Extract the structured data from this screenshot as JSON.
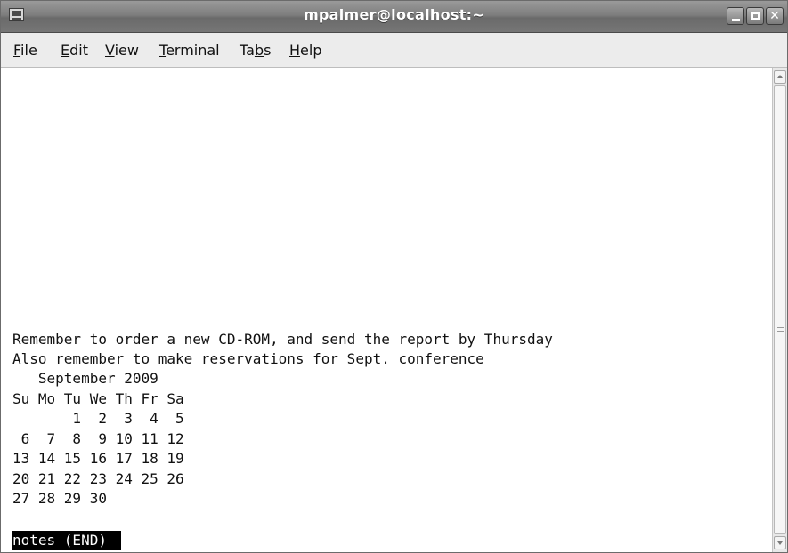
{
  "window": {
    "title": "mpalmer@localhost:~"
  },
  "menu": {
    "items": [
      {
        "pre": "",
        "key": "F",
        "post": "ile"
      },
      {
        "pre": "",
        "key": "E",
        "post": "dit"
      },
      {
        "pre": "",
        "key": "V",
        "post": "iew"
      },
      {
        "pre": "",
        "key": "T",
        "post": "erminal"
      },
      {
        "pre": "Ta",
        "key": "b",
        "post": "s"
      },
      {
        "pre": "",
        "key": "H",
        "post": "elp"
      }
    ]
  },
  "terminal": {
    "lines": [
      "Remember to order a new CD-ROM, and send the report by Thursday",
      "Also remember to make reservations for Sept. conference",
      "   September 2009",
      "Su Mo Tu We Th Fr Sa",
      "       1  2  3  4  5",
      " 6  7  8  9 10 11 12",
      "13 14 15 16 17 18 19",
      "20 21 22 23 24 25 26",
      "27 28 29 30"
    ],
    "status": "notes (END)"
  }
}
